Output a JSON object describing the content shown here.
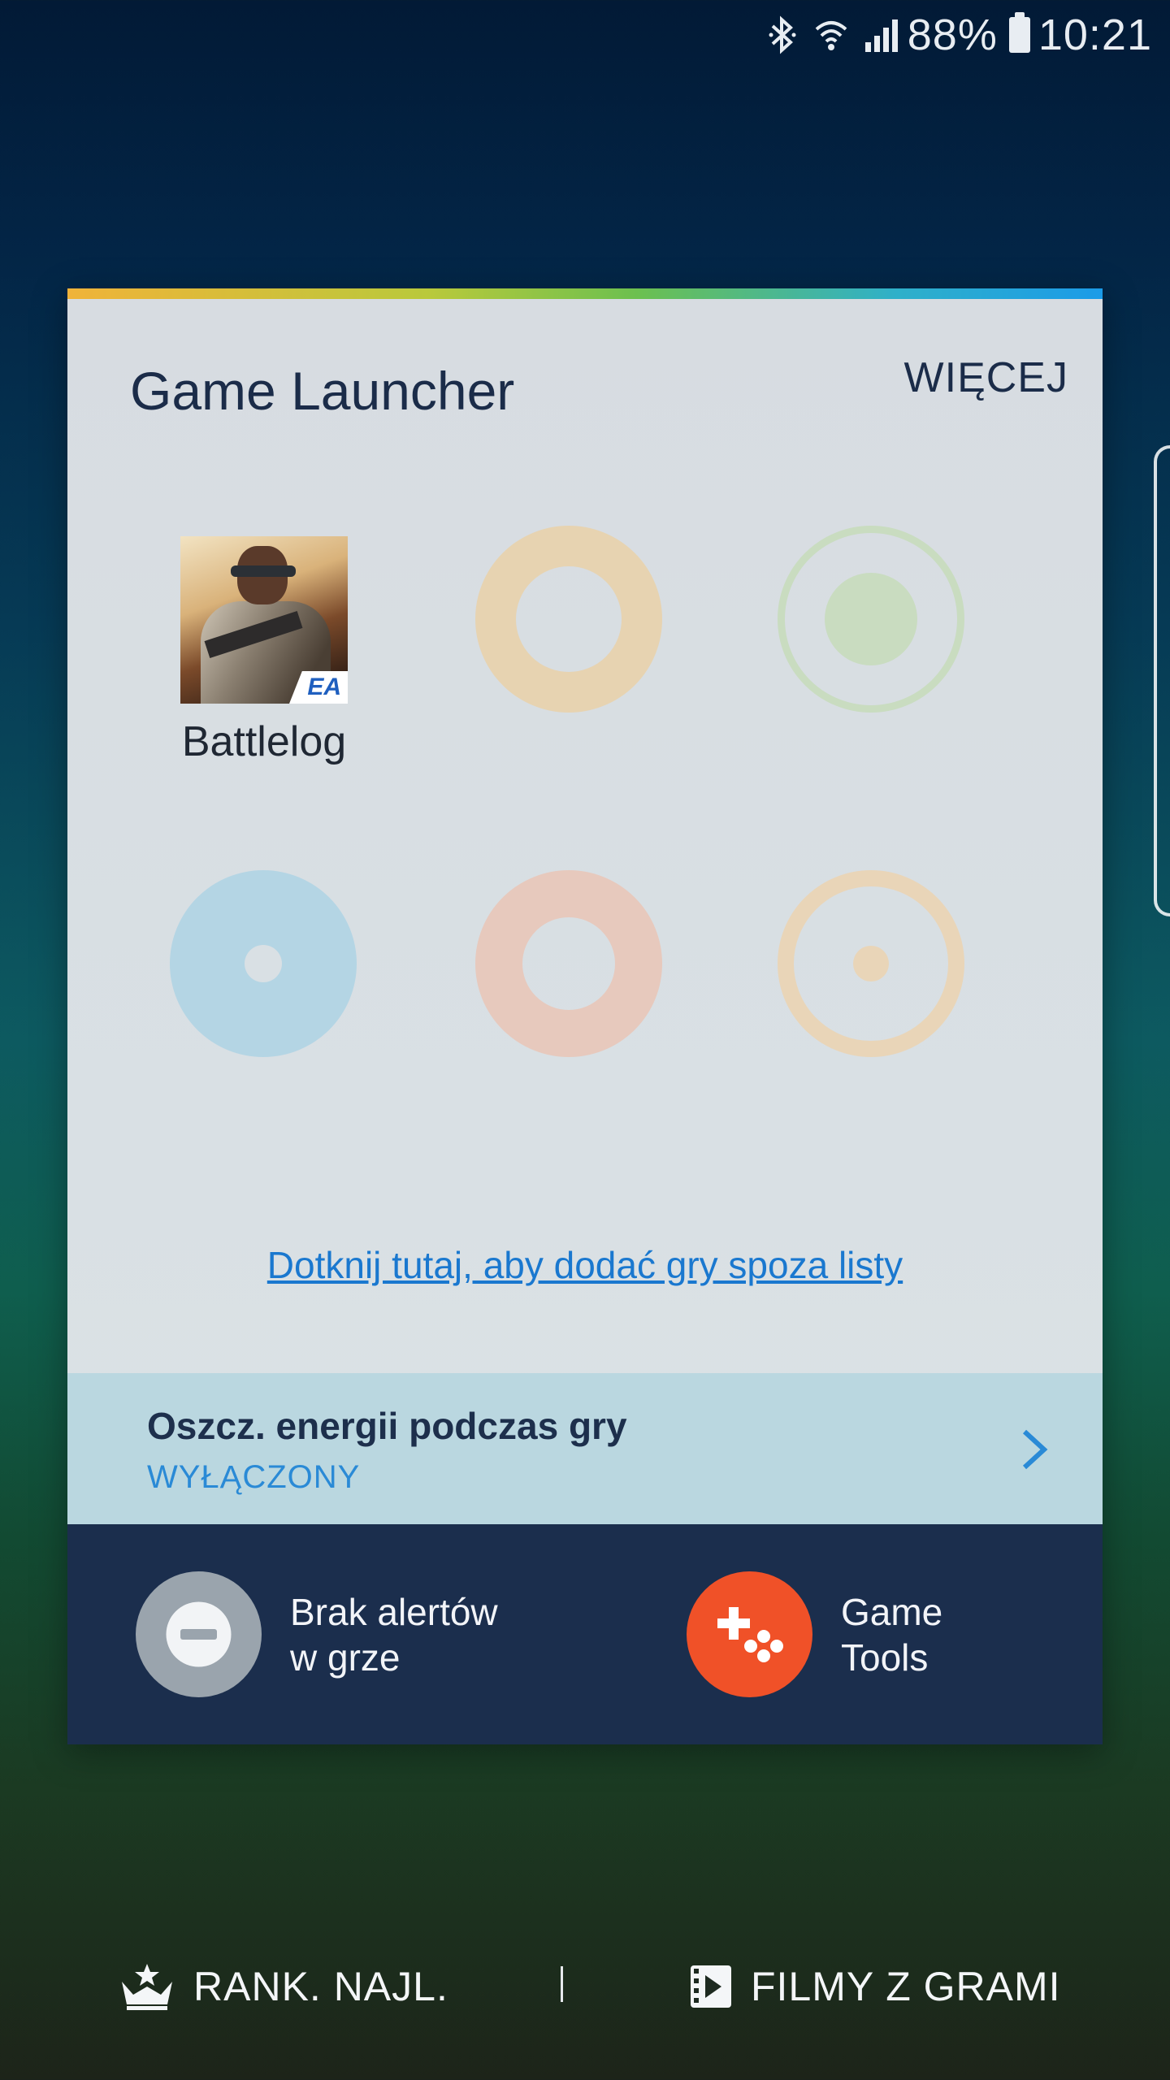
{
  "status_bar": {
    "battery": "88%",
    "time": "10:21",
    "icons": [
      "bluetooth-icon",
      "wifi-icon",
      "signal-icon",
      "battery-icon"
    ]
  },
  "card": {
    "title": "Game Launcher",
    "more_label": "WIĘCEJ",
    "games": [
      {
        "name": "Battlelog",
        "publisher_badge": "EA"
      }
    ],
    "placeholder_slots": [
      "orange-ring",
      "green-ring",
      "blue-disc",
      "red-ring",
      "orange-ring-dot"
    ],
    "add_link": "Dotknij tutaj, aby dodać gry spoza listy",
    "energy": {
      "title": "Oszcz. energii podczas gry",
      "status": "WYŁĄCZONY"
    },
    "actions": {
      "no_alerts": {
        "line1": "Brak alertów",
        "line2": "w grze"
      },
      "game_tools": {
        "line1": "Game",
        "line2": "Tools"
      }
    }
  },
  "bottom_nav": {
    "ranking": "RANK. NAJL.",
    "videos": "FILMY Z GRAMI"
  },
  "colors": {
    "card_bg": "#d7dce1",
    "accent_blue": "#2a8ad6",
    "panel": "#1b2e4d",
    "game_tools": "#f05128",
    "no_alerts": "#9aa4ad"
  }
}
